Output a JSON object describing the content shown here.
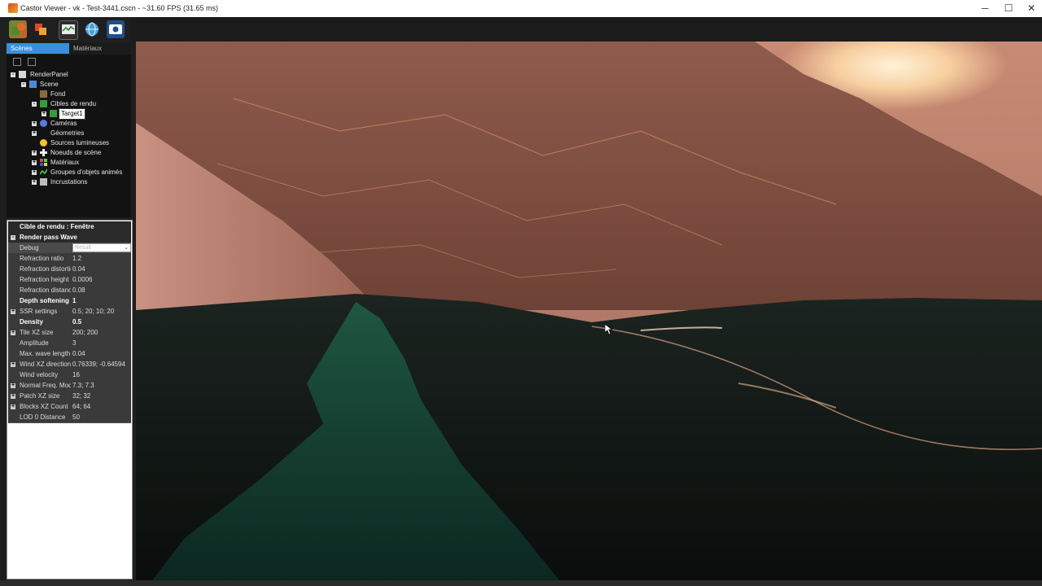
{
  "window": {
    "title": "Castor Viewer - vk - Test-3441.cscn - ~31.60 FPS (31.65 ms)",
    "minimize": "─",
    "maximize": "☐",
    "close": "✕"
  },
  "toolbar": {
    "buttons": [
      {
        "name": "open-scene-icon"
      },
      {
        "name": "export-icon"
      },
      {
        "name": "render-view-icon"
      },
      {
        "name": "globe-icon"
      },
      {
        "name": "screenshot-icon"
      }
    ]
  },
  "tabs": [
    {
      "label": "Scènes",
      "active": true
    },
    {
      "label": "Matériaux",
      "active": false
    }
  ],
  "tree": {
    "items": [
      {
        "label": "RenderPanel",
        "expander": "-"
      },
      {
        "label": "Scene",
        "expander": "-"
      },
      {
        "label": "Fond",
        "expander": ""
      },
      {
        "label": "Cibles de rendu",
        "expander": "-"
      },
      {
        "label": "Target1",
        "expander": "+",
        "selected": true
      },
      {
        "label": "Caméras",
        "expander": "+"
      },
      {
        "label": "Géometries",
        "expander": "+"
      },
      {
        "label": "Sources lumineuses",
        "expander": ""
      },
      {
        "label": "Noeuds de scène",
        "expander": "+"
      },
      {
        "label": "Matériaux",
        "expander": "+"
      },
      {
        "label": "Groupes d'objets animés",
        "expander": "+"
      },
      {
        "label": "Incrustations",
        "expander": "+"
      }
    ]
  },
  "properties": {
    "title": "Cible de rendu : Fenêtre",
    "group": "Render pass Wave",
    "debug": {
      "label": "Debug",
      "value": "Result"
    },
    "rows": [
      {
        "name": "Refraction ratio",
        "value": "1.2"
      },
      {
        "name": "Refraction distortion",
        "value": "0.04"
      },
      {
        "name": "Refraction height",
        "value": "0.0006"
      },
      {
        "name": "Refraction distance",
        "value": "0.08"
      },
      {
        "name": "Depth softening",
        "value": "1"
      },
      {
        "name": "SSR settings",
        "value": "0.5; 20; 10; 20"
      },
      {
        "name": "Density",
        "value": "0.5"
      },
      {
        "name": "Tile XZ size",
        "value": "200; 200"
      },
      {
        "name": "Amplitude",
        "value": "3"
      },
      {
        "name": "Max. wave length",
        "value": "0.04"
      },
      {
        "name": "Wind XZ direction",
        "value": "0.76339; -0.64594"
      },
      {
        "name": "Wind velocity",
        "value": "16"
      },
      {
        "name": "Normal Freq. Mod.",
        "value": "7.3; 7.3"
      },
      {
        "name": "Patch XZ size",
        "value": "32; 32"
      },
      {
        "name": "Blocks XZ Count",
        "value": "64; 64"
      },
      {
        "name": "LOD 0 Distance",
        "value": "50"
      }
    ]
  },
  "colors": {
    "accent": "#3a8fdc",
    "sky": "#c9806b",
    "mountain": "#8a5646",
    "water": "#0f1a15"
  }
}
